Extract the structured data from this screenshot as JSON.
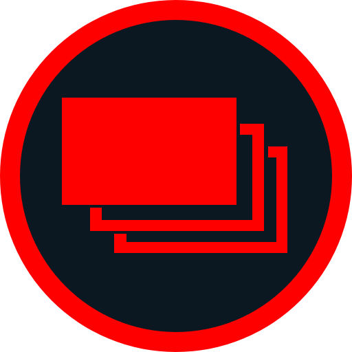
{
  "icon": {
    "name": "stacked-cards-icon",
    "colors": {
      "accent": "#FF0000",
      "background": "#0B1821",
      "page": "#FFFFFF"
    }
  }
}
